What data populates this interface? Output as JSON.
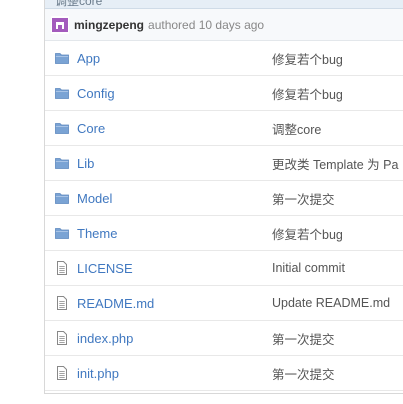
{
  "commit": {
    "title": "调整core",
    "author": "mingzepeng",
    "meta": "authored 10 days ago"
  },
  "files": [
    {
      "name": "App",
      "type": "folder",
      "message": "修复若个bug"
    },
    {
      "name": "Config",
      "type": "folder",
      "message": "修复若个bug"
    },
    {
      "name": "Core",
      "type": "folder",
      "message": "调整core"
    },
    {
      "name": "Lib",
      "type": "folder",
      "message": "更改类 Template 为 Pa"
    },
    {
      "name": "Model",
      "type": "folder",
      "message": "第一次提交"
    },
    {
      "name": "Theme",
      "type": "folder",
      "message": "修复若个bug"
    },
    {
      "name": "LICENSE",
      "type": "file",
      "message": "Initial commit"
    },
    {
      "name": "README.md",
      "type": "file",
      "message": "Update README.md"
    },
    {
      "name": "index.php",
      "type": "file",
      "message": "第一次提交"
    },
    {
      "name": "init.php",
      "type": "file",
      "message": "第一次提交"
    }
  ],
  "colors": {
    "link": "#4078c0",
    "folder_icon": "#7aa3d4",
    "avatar": "#9b59b6"
  }
}
